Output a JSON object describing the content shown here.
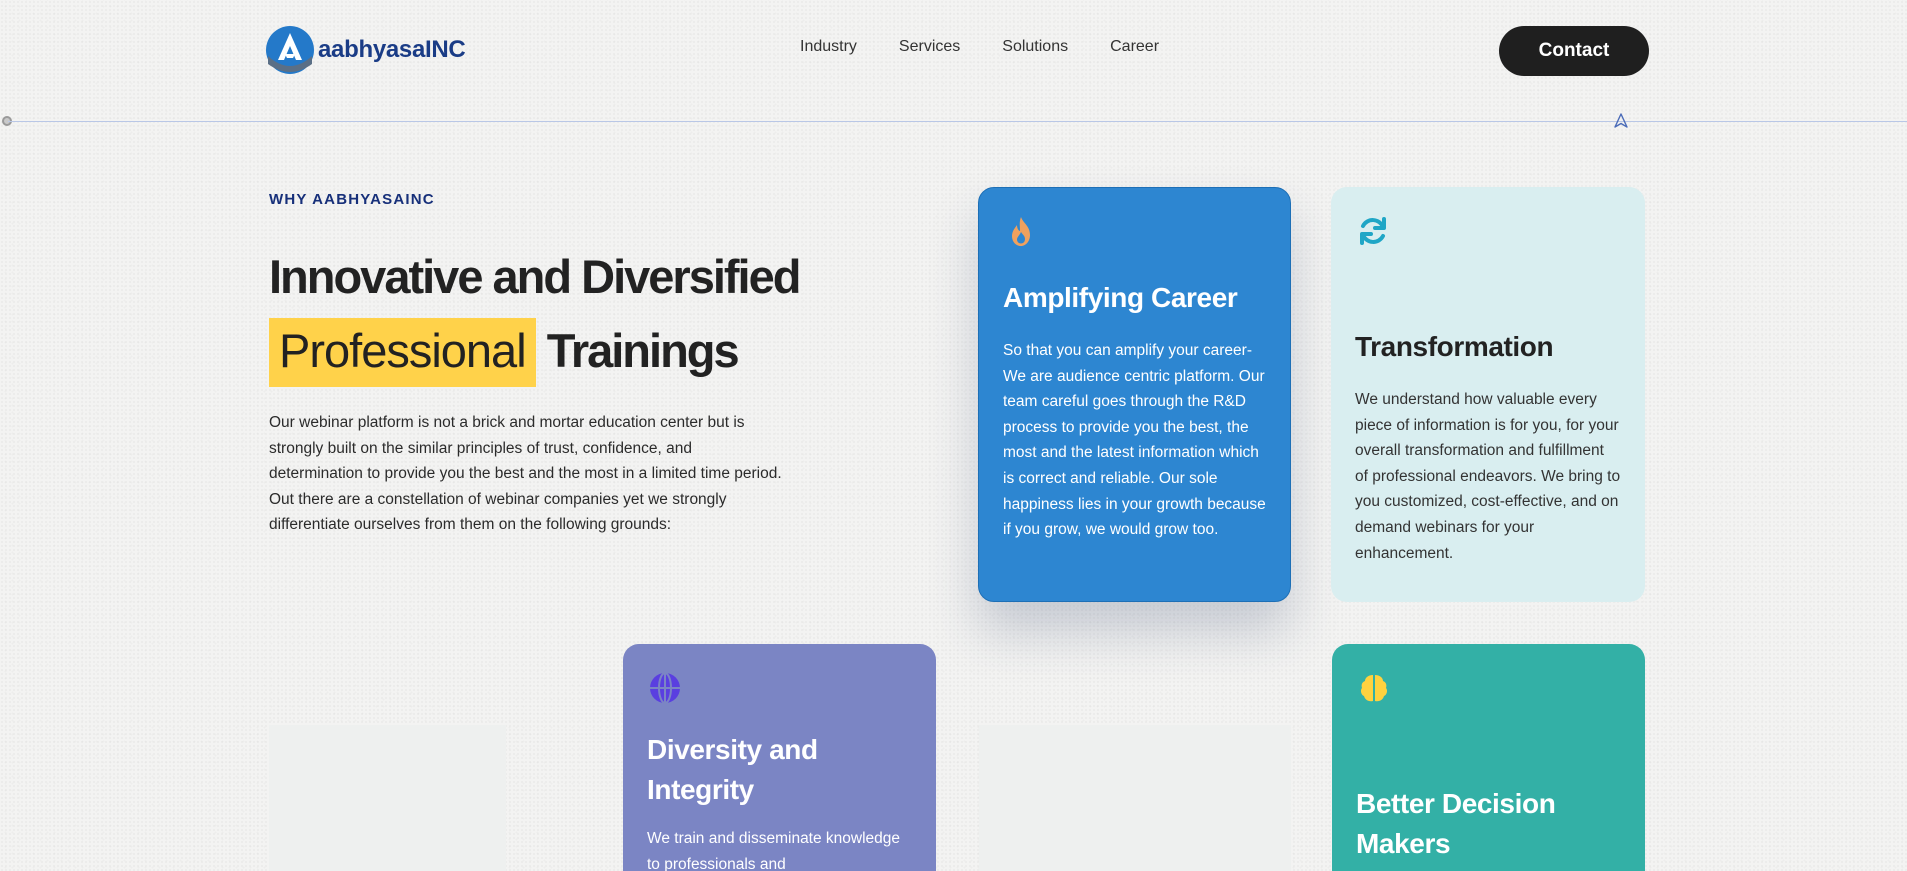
{
  "header": {
    "logo_text": "aabhyasaINC",
    "nav": [
      "Industry",
      "Services",
      "Solutions",
      "Career"
    ],
    "contact_label": "Contact"
  },
  "intro": {
    "eyebrow": "WHY AABHYASAINC",
    "headline_line1": "Innovative and Diversified",
    "headline_highlight": "Professional",
    "headline_rest": "Trainings",
    "paragraph1": "Our webinar platform is not a brick and mortar education center but is strongly built on the similar principles of trust, confidence, and determination to provide you the best and the most in a limited time period.",
    "paragraph2": "Out there are a constellation of webinar companies yet we strongly differentiate ourselves from them on the following grounds:"
  },
  "cards": {
    "amplify": {
      "icon": "fire-icon",
      "title": "Amplifying Career",
      "text": "So that you can amplify your career- We are audience centric platform. Our team careful goes through the R&D process to provide you the best, the most and the latest information which is correct and reliable. Our sole happiness lies in your growth because if you grow, we would grow too."
    },
    "transform": {
      "icon": "refresh-icon",
      "title": "Transformation",
      "text": "We understand how valuable every piece of information is for you, for your overall transformation and fulfillment of professional endeavors. We bring to you customized, cost-effective, and on demand webinars for your enhancement."
    },
    "diversity": {
      "icon": "globe-icon",
      "title": "Diversity and Integrity",
      "text": "We train and disseminate knowledge to professionals and"
    },
    "decision": {
      "icon": "brain-icon",
      "title": "Better Decision Makers"
    }
  },
  "colors": {
    "brand_navy": "#1a3c86",
    "highlight_yellow": "#ffd24a",
    "card_blue": "#2d86d1",
    "card_light_teal": "#d9eef0",
    "card_purple": "#7b85c4",
    "card_teal": "#33b0a6"
  }
}
